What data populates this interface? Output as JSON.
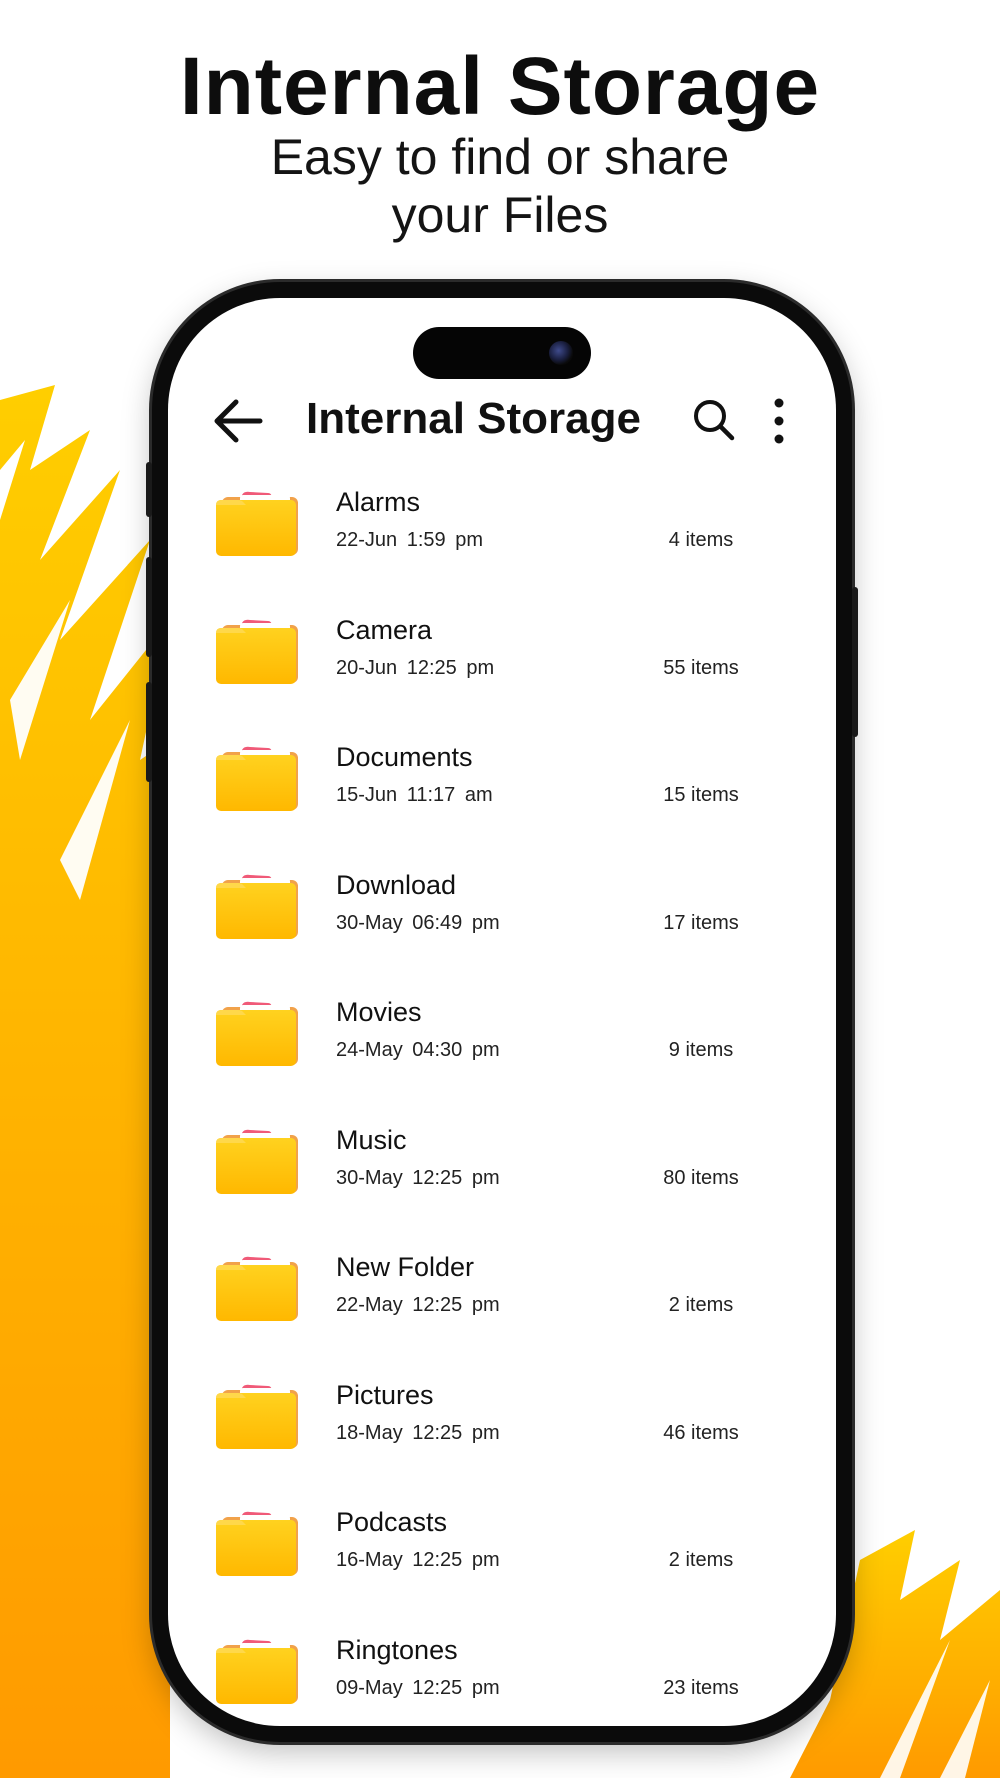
{
  "promo": {
    "title": "Internal Storage",
    "subtitle_line1": "Easy to find or share",
    "subtitle_line2": "your Files"
  },
  "theme": {
    "accent": "#ffb300",
    "folder_color": "#ffcc1a",
    "folder_tab": "#f06070"
  },
  "app_bar": {
    "back_icon": "arrow-left-icon",
    "title": "Internal Storage",
    "search_icon": "search-icon",
    "more_icon": "more-vertical-icon"
  },
  "folders": [
    {
      "name": "Alarms",
      "date": "22-Jun   1:59 pm",
      "count": "4 items"
    },
    {
      "name": "Camera",
      "date": "20-Jun   12:25 pm",
      "count": "55 items"
    },
    {
      "name": "Documents",
      "date": "15-Jun   11:17 am",
      "count": "15 items"
    },
    {
      "name": "Download",
      "date": "30-May   06:49 pm",
      "count": "17 items"
    },
    {
      "name": "Movies",
      "date": "24-May   04:30 pm",
      "count": "9 items"
    },
    {
      "name": "Music",
      "date": "30-May   12:25 pm",
      "count": "80 items"
    },
    {
      "name": "New Folder",
      "date": "22-May   12:25 pm",
      "count": "2 items"
    },
    {
      "name": "Pictures",
      "date": "18-May   12:25 pm",
      "count": "46 items"
    },
    {
      "name": "Podcasts",
      "date": "16-May   12:25 pm",
      "count": "2 items"
    },
    {
      "name": "Ringtones",
      "date": "09-May   12:25 pm",
      "count": "23 items"
    }
  ]
}
